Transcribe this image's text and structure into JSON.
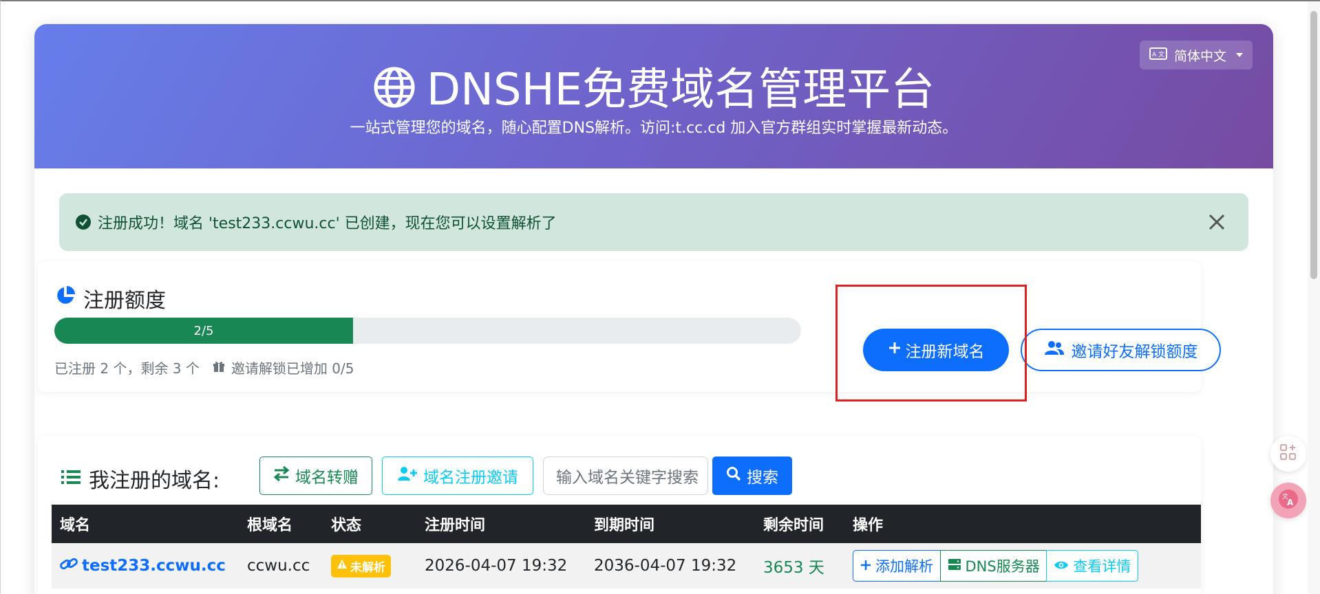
{
  "header": {
    "title": "DNSHE免费域名管理平台",
    "subtitle": "一站式管理您的域名，随心配置DNS解析。访问:t.cc.cd 加入官方群组实时掌握最新动态。",
    "language": "简体中文"
  },
  "alert": {
    "message": "注册成功！域名 'test233.ccwu.cc' 已创建，现在您可以设置解析了"
  },
  "quota": {
    "title": "注册额度",
    "progress_label": "2/5",
    "progress_value": 0.4,
    "used_text": "已注册 2 个，剩余 3 个",
    "invite_text": "邀请解锁已增加 0/5",
    "register_button": "注册新域名",
    "invite_button": "邀请好友解锁额度"
  },
  "domains": {
    "title": "我注册的域名:",
    "transfer_button": "域名转赠",
    "reg_invite_button": "域名注册邀请",
    "search_placeholder": "输入域名关键字搜索",
    "search_button": "搜索",
    "columns": [
      "域名",
      "根域名",
      "状态",
      "注册时间",
      "到期时间",
      "剩余时间",
      "操作"
    ],
    "rows": [
      {
        "domain": "test233.ccwu.cc",
        "root": "ccwu.cc",
        "status": "未解析",
        "registered": "2026-04-07 19:32",
        "expires": "2036-04-07 19:32",
        "remaining": "3653 天",
        "actions": [
          "添加解析",
          "DNS服务器",
          "查看详情"
        ]
      }
    ]
  },
  "colors": {
    "primary": "#0d6efd",
    "success": "#198754",
    "info": "#0dcaf0",
    "warning": "#ffc107",
    "hero_start": "#667eea",
    "hero_end": "#764ba2",
    "highlight": "#e02020"
  }
}
